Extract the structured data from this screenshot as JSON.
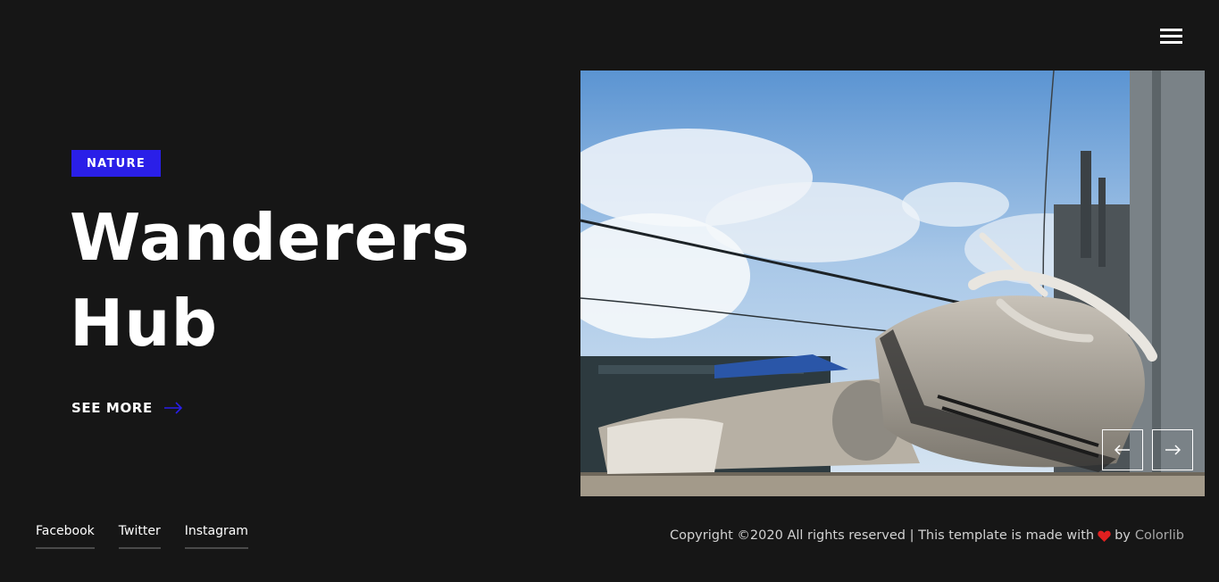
{
  "header": {
    "menu_icon": "hamburger-icon"
  },
  "hero": {
    "category": "NATURE",
    "title_line1": "Wanderers",
    "title_line2": "Hub",
    "see_more": "SEE MORE",
    "accent_color": "#2a1fe8"
  },
  "social": {
    "links": [
      "Facebook",
      "Twitter",
      "Instagram"
    ]
  },
  "slider": {
    "prev_icon": "arrow-left-icon",
    "next_icon": "arrow-right-icon"
  },
  "footer": {
    "copyright_text": "Copyright ©2020 All rights reserved | This template is made with",
    "by": "by",
    "brand": "Colorlib",
    "heart_color": "#e02020"
  }
}
